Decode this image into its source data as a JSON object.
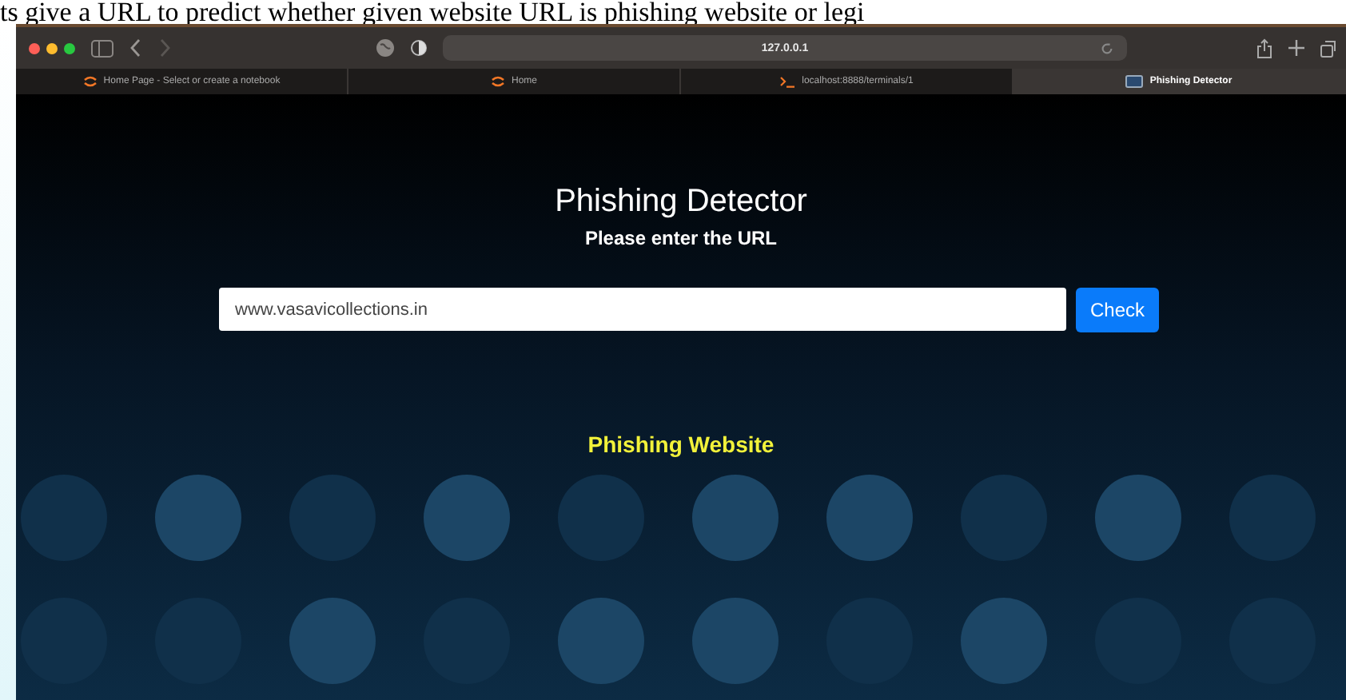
{
  "caption": "ts give a URL to predict whether given website URL is phishing website or legi",
  "browser": {
    "address": "127.0.0.1",
    "tabs": [
      {
        "label": "Home Page - Select or create a notebook",
        "kind": "jupyter",
        "selected": false
      },
      {
        "label": "Home",
        "kind": "jupyter",
        "selected": false
      },
      {
        "label": "localhost:8888/terminals/1",
        "kind": "terminal",
        "selected": false
      },
      {
        "label": "Phishing Detector",
        "kind": "page",
        "selected": true
      }
    ]
  },
  "page": {
    "title": "Phishing Detector",
    "subtitle": "Please enter the URL",
    "url_field": {
      "value": "www.vasavicollections.in"
    },
    "button": "Check",
    "result": "Phishing Website"
  }
}
